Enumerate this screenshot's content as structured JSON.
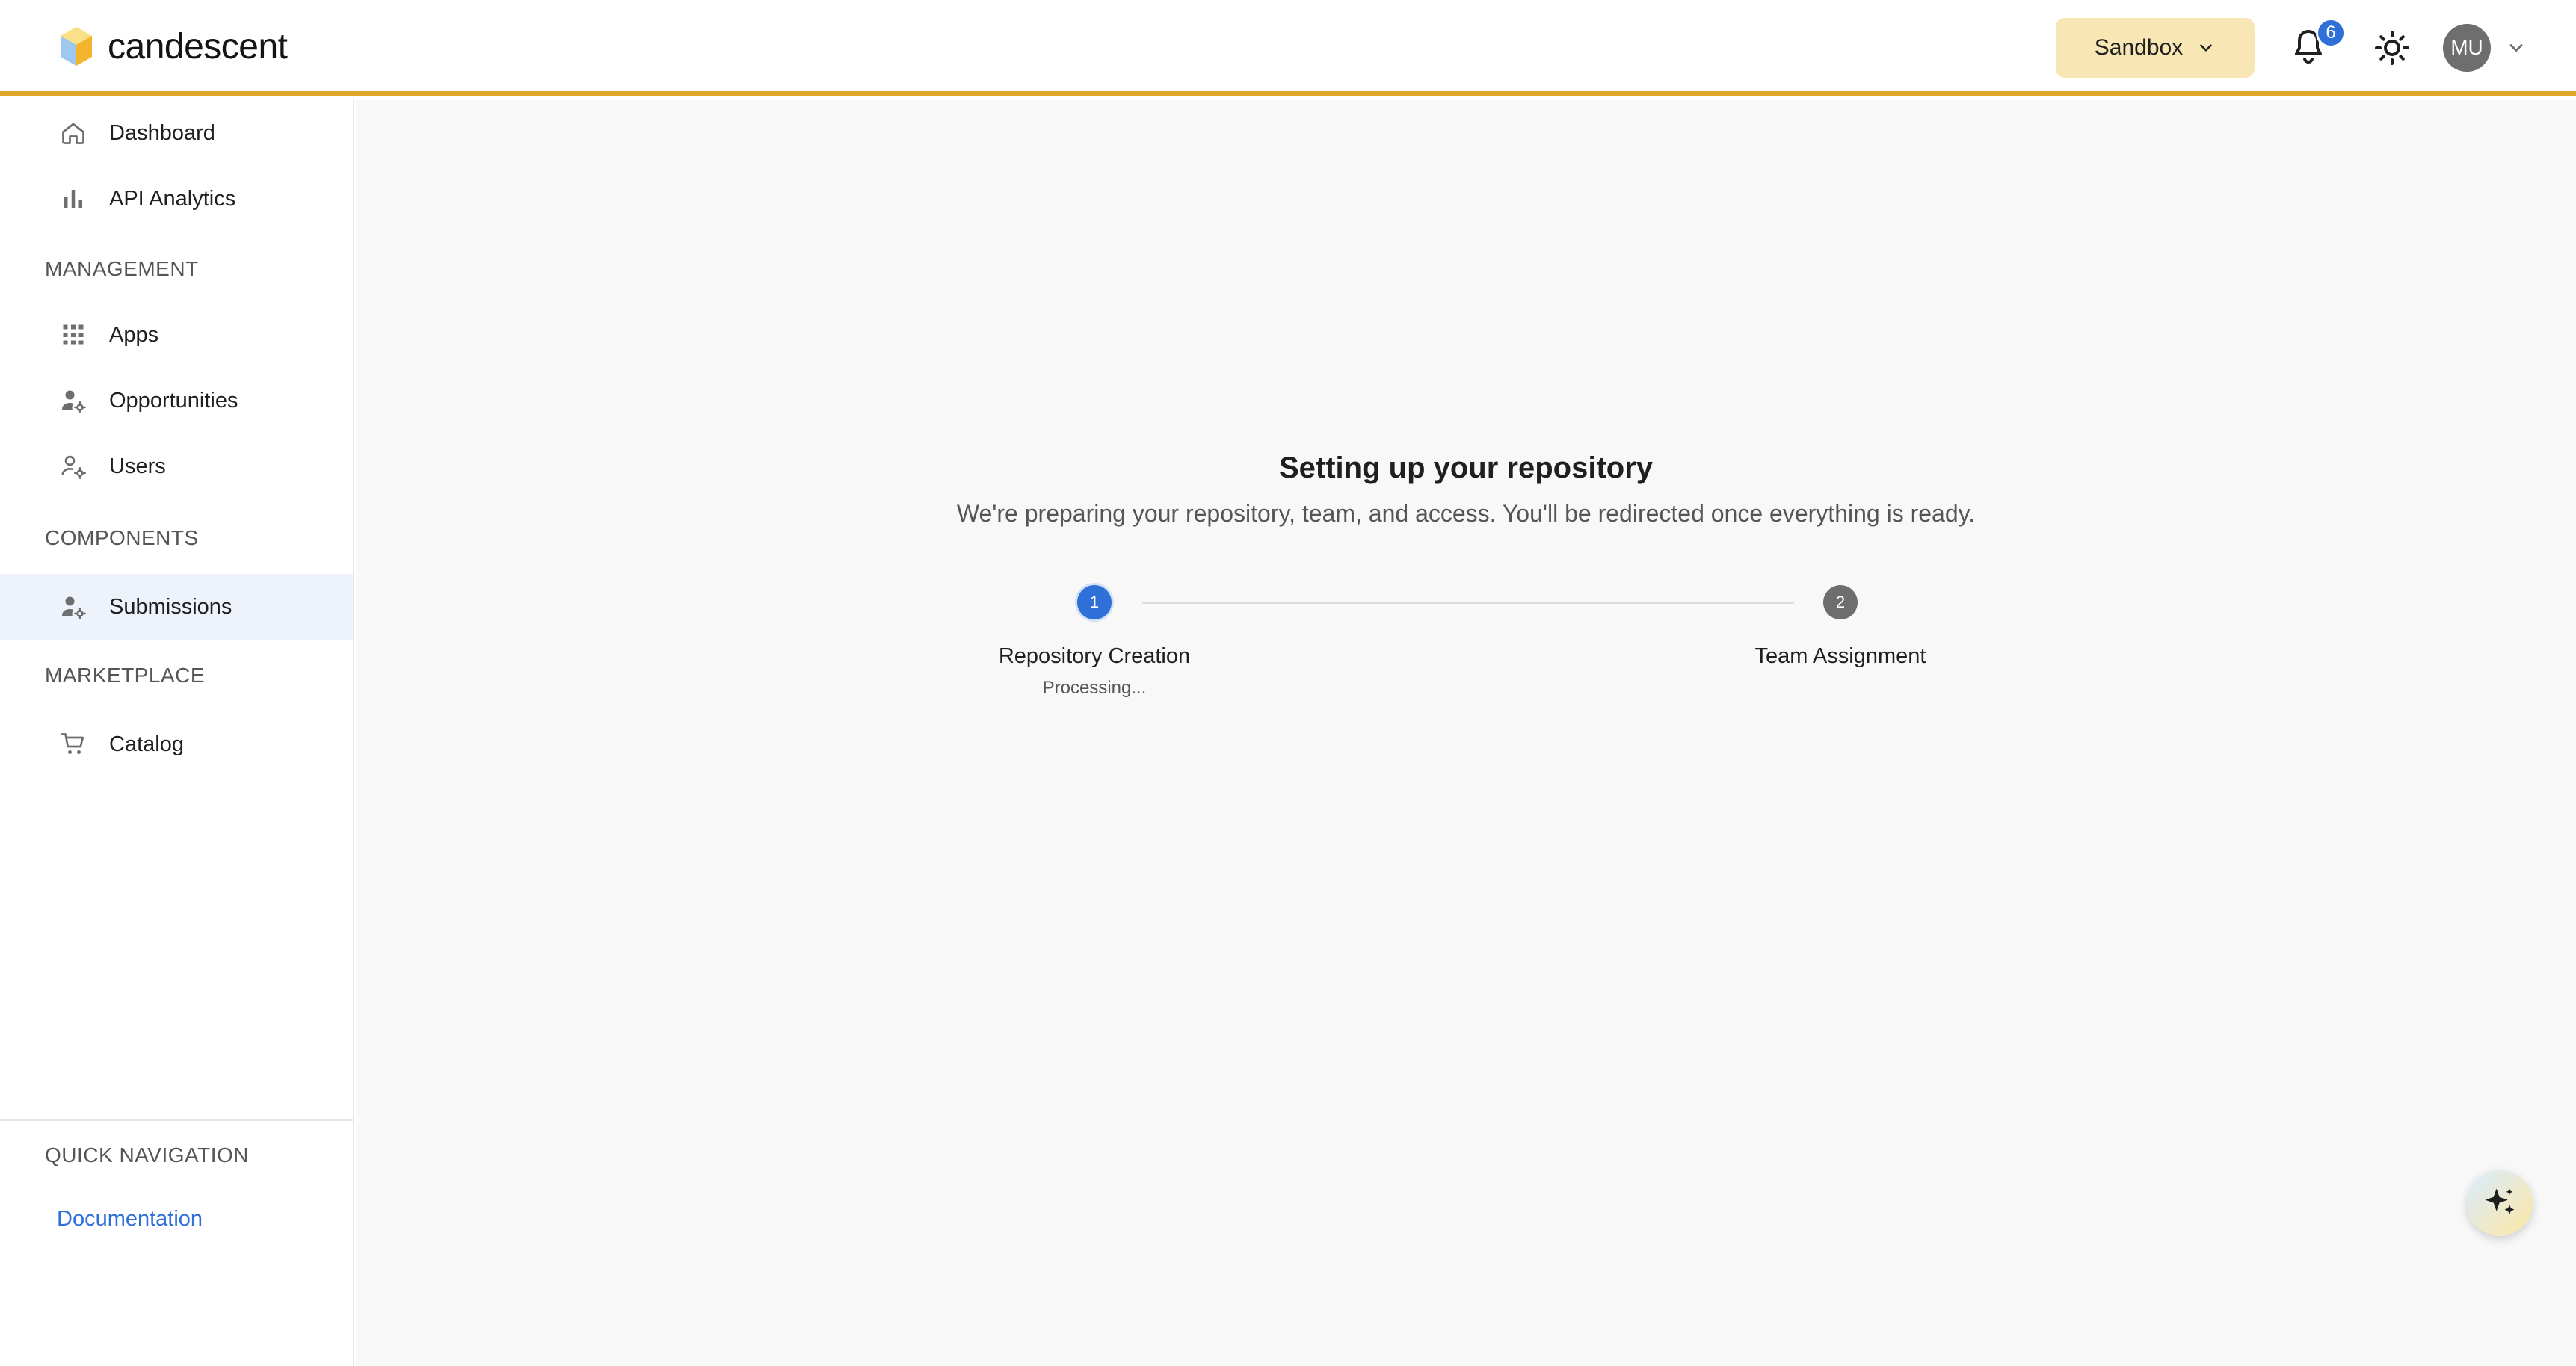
{
  "header": {
    "brand": "candescent",
    "environment": "Sandbox",
    "notification_count": "6",
    "user_initials": "MU",
    "accent_color": "#e0a72b",
    "env_bg_color": "#f8e7b4"
  },
  "sidebar": {
    "top_items": [
      {
        "label": "Dashboard",
        "icon": "home-icon"
      },
      {
        "label": "API Analytics",
        "icon": "bar-chart-icon"
      }
    ],
    "sections": [
      {
        "title": "MANAGEMENT",
        "items": [
          {
            "label": "Apps",
            "icon": "grid-icon"
          },
          {
            "label": "Opportunities",
            "icon": "user-gear-icon"
          },
          {
            "label": "Users",
            "icon": "user-gear-outline-icon"
          }
        ]
      },
      {
        "title": "COMPONENTS",
        "items": [
          {
            "label": "Submissions",
            "icon": "user-gear-icon",
            "active": true
          }
        ]
      },
      {
        "title": "MARKETPLACE",
        "items": [
          {
            "label": "Catalog",
            "icon": "cart-icon"
          }
        ]
      }
    ],
    "quick_nav": {
      "title": "QUICK NAVIGATION",
      "link": "Documentation"
    }
  },
  "main": {
    "title": "Setting up your repository",
    "subtitle": "We're preparing your repository, team, and access. You'll be redirected once everything is ready.",
    "steps": [
      {
        "number": "1",
        "label": "Repository Creation",
        "status": "Processing...",
        "state": "active"
      },
      {
        "number": "2",
        "label": "Team Assignment",
        "status": "",
        "state": "pending"
      }
    ]
  }
}
